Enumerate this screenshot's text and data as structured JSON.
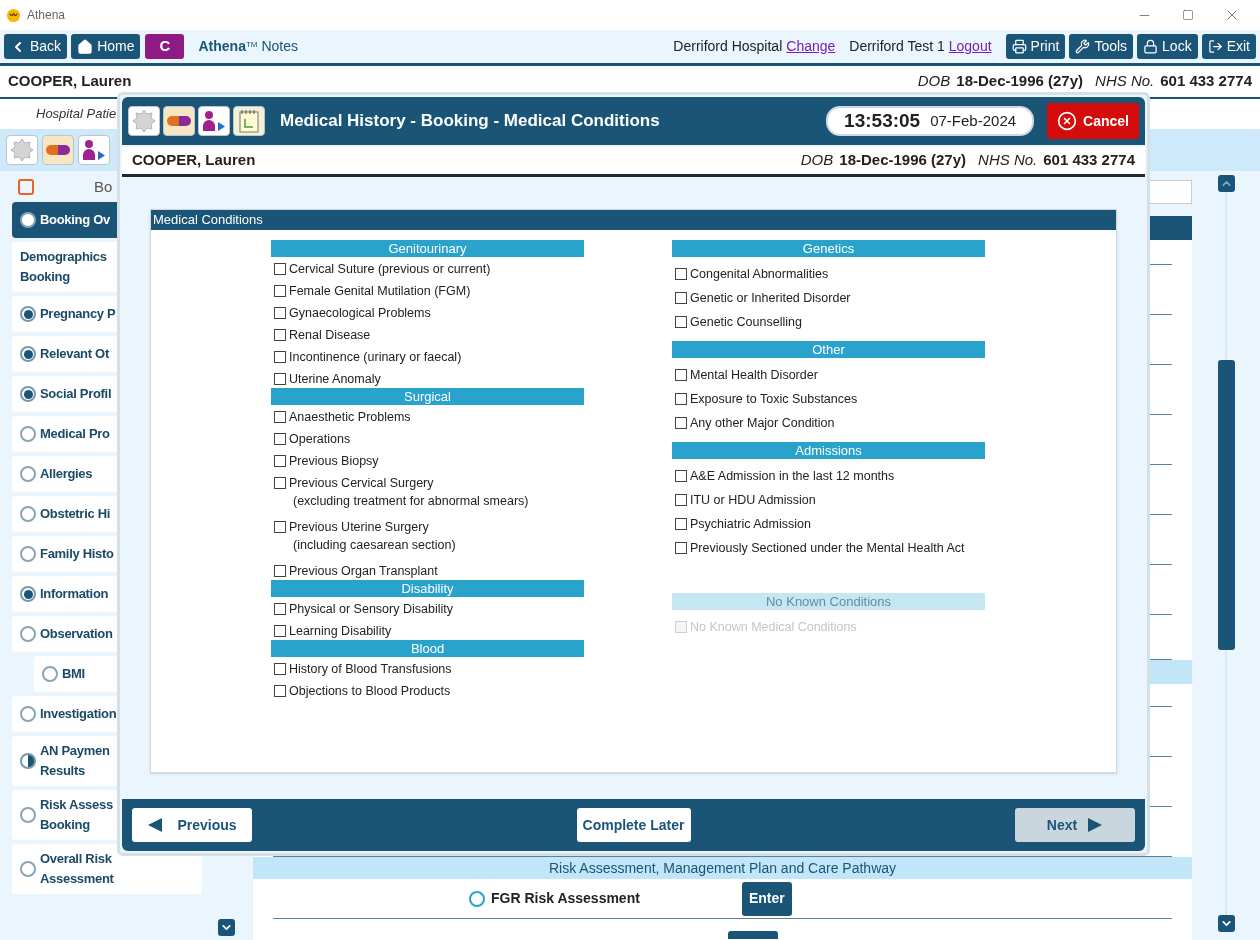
{
  "window": {
    "title": "Athena"
  },
  "toolbar": {
    "left_buttons": [
      "Back",
      "Home"
    ],
    "c_button": "C",
    "app_name": "**Athena**$^{TM}$ Notes",
    "location": "Derriford Hospital",
    "change_link": "Change",
    "user": "Derriford Test 1",
    "logout_link": "Logout",
    "right_buttons": [
      "Print",
      "Tools",
      "Lock",
      "Exit"
    ]
  },
  "patient": {
    "name": "COOPER, Lauren",
    "dob_label": "DOB",
    "dob": "18-Dec-1996 (27y)",
    "nhs_label": "NHS No.",
    "nhs": "601 433 2774"
  },
  "subheader": "Hospital Patie",
  "sidebar": {
    "header": "Bo",
    "items": [
      {
        "label": "Booking Ov",
        "kind": "empty",
        "selected": true
      },
      {
        "label": "Demographics",
        "line2": "Booking",
        "kind": "plain",
        "selected": false
      },
      {
        "label": "Pregnancy P",
        "kind": "complete",
        "selected": false
      },
      {
        "label": "Relevant Ot",
        "kind": "complete",
        "selected": false
      },
      {
        "label": "Social Profil",
        "kind": "complete",
        "selected": false
      },
      {
        "label": "Medical Pro",
        "kind": "empty",
        "selected": false
      },
      {
        "label": "Allergies",
        "kind": "empty",
        "selected": false
      },
      {
        "label": "Obstetric Hi",
        "kind": "empty",
        "selected": false
      },
      {
        "label": "Family Histo",
        "kind": "empty",
        "selected": false
      },
      {
        "label": "Information",
        "kind": "complete",
        "selected": false
      },
      {
        "label": "Observation",
        "kind": "empty",
        "selected": false,
        "children": [
          {
            "label": "BMI",
            "kind": "empty",
            "selected": false
          }
        ]
      },
      {
        "label": "Investigation",
        "kind": "empty",
        "selected": false
      },
      {
        "label": "AN Paymen",
        "line2": "Results",
        "kind": "partial",
        "selected": false
      },
      {
        "label": "Risk Assess",
        "line2": "Booking",
        "kind": "empty",
        "selected": false
      },
      {
        "label": "Overall Risk",
        "line2": "Assessment",
        "kind": "empty",
        "selected": false
      }
    ]
  },
  "main": {
    "band": "Risk Assessment, Management Plan and Care Pathway",
    "row": {
      "label": "FGR Risk Assessment",
      "button": "Enter"
    }
  },
  "dialog": {
    "title": "Medical History - Booking - Medical Conditions",
    "time": "13:53:05",
    "date": "07-Feb-2024",
    "cancel": "Cancel",
    "patient": {
      "name": "COOPER, Lauren",
      "dob_label": "DOB",
      "dob": "18-Dec-1996 (27y)",
      "nhs_label": "NHS No.",
      "nhs": "601 433 2774"
    },
    "card_title": "Medical Conditions",
    "columns": [
      [
        {
          "title": "Genitourinary",
          "disabled": false,
          "items": [
            {
              "label": "Cervical Suture (previous or current)",
              "checked": false
            },
            {
              "label": "Female Genital Mutilation (FGM)",
              "checked": false
            },
            {
              "label": "Gynaecological Problems",
              "checked": false
            },
            {
              "label": "Renal Disease",
              "checked": false
            },
            {
              "label": "Incontinence (urinary or faecal)",
              "checked": false
            },
            {
              "label": "Uterine Anomaly",
              "checked": false
            }
          ]
        },
        {
          "title": "Surgical",
          "disabled": false,
          "items": [
            {
              "label": "Anaesthetic Problems",
              "checked": false
            },
            {
              "label": "Operations",
              "checked": false
            },
            {
              "label": "Previous Biopsy",
              "checked": false
            },
            {
              "label": "Previous Cervical Surgery",
              "note": "(excluding treatment for abnormal smears)",
              "checked": false
            },
            {
              "label": "Previous Uterine Surgery",
              "note": "(including caesarean section)",
              "checked": false
            },
            {
              "label": "Previous Organ Transplant",
              "checked": false
            }
          ]
        },
        {
          "title": "Disability",
          "disabled": false,
          "items": [
            {
              "label": "Physical or Sensory Disability",
              "checked": false
            },
            {
              "label": "Learning Disability",
              "checked": false
            }
          ]
        },
        {
          "title": "Blood",
          "disabled": false,
          "items": [
            {
              "label": "History of Blood Transfusions",
              "checked": false
            },
            {
              "label": "Objections to Blood Products",
              "checked": false
            }
          ]
        }
      ],
      [
        {
          "title": "Genetics",
          "disabled": false,
          "items": [
            {
              "label": "Congenital Abnormalities",
              "checked": false
            },
            {
              "label": "Genetic or Inherited Disorder",
              "checked": false
            },
            {
              "label": "Genetic Counselling",
              "checked": false
            }
          ]
        },
        {
          "title": "Other",
          "disabled": false,
          "items": [
            {
              "label": "Mental Health Disorder",
              "checked": false
            },
            {
              "label": "Exposure to Toxic Substances",
              "checked": false
            },
            {
              "label": "Any other Major Condition",
              "checked": false
            }
          ]
        },
        {
          "title": "Admissions",
          "disabled": false,
          "items": [
            {
              "label": "A&E Admission in the last 12 months",
              "checked": false
            },
            {
              "label": "ITU or HDU Admission",
              "checked": false
            },
            {
              "label": "Psychiatric Admission",
              "checked": false
            },
            {
              "label": "Previously Sectioned under the Mental Health Act",
              "checked": false
            }
          ]
        },
        {
          "title": "No Known Conditions",
          "disabled": true,
          "items": [
            {
              "label": "No Known Medical Conditions",
              "checked": false
            }
          ]
        }
      ]
    ],
    "footer": {
      "previous": "Previous",
      "complete_later": "Complete Later",
      "next": {
        "label": "Next",
        "disabled": true
      }
    }
  }
}
